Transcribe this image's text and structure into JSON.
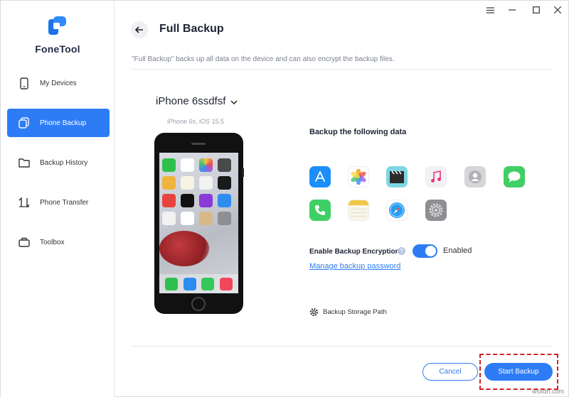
{
  "app": {
    "name": "FoneTool",
    "brand_color": "#2d7cf6"
  },
  "window_controls": {
    "menu_icon": "menu-icon",
    "minimize_icon": "minimize-icon",
    "maximize_icon": "maximize-icon",
    "close_icon": "close-icon"
  },
  "sidebar": {
    "items": [
      {
        "label": "My Devices",
        "icon": "phone-icon",
        "active": false
      },
      {
        "label": "Phone Backup",
        "icon": "backup-icon",
        "active": true
      },
      {
        "label": "Backup History",
        "icon": "folder-icon",
        "active": false
      },
      {
        "label": "Phone Transfer",
        "icon": "transfer-icon",
        "active": false
      },
      {
        "label": "Toolbox",
        "icon": "toolbox-icon",
        "active": false
      }
    ]
  },
  "header": {
    "title": "Full Backup",
    "subtitle": "\"Full Backup\" backs up all data on the device and can also encrypt the backup files."
  },
  "device": {
    "name": "iPhone 6ssdfsf",
    "model": "iPhone 6s, iOS 15.5"
  },
  "backup": {
    "section_title": "Backup the following data",
    "data_types": [
      "app-store-icon",
      "photos-icon",
      "videos-icon",
      "music-icon",
      "contacts-icon",
      "messages-icon",
      "phone-icon",
      "notes-icon",
      "safari-icon",
      "settings-icon"
    ],
    "encryption_label": "Enable Backup Encryption",
    "encryption_state": "Enabled",
    "manage_password": "Manage backup password",
    "storage_path": "Backup Storage Path"
  },
  "footer": {
    "cancel": "Cancel",
    "start": "Start Backup"
  },
  "watermark": "wsxdn.com"
}
